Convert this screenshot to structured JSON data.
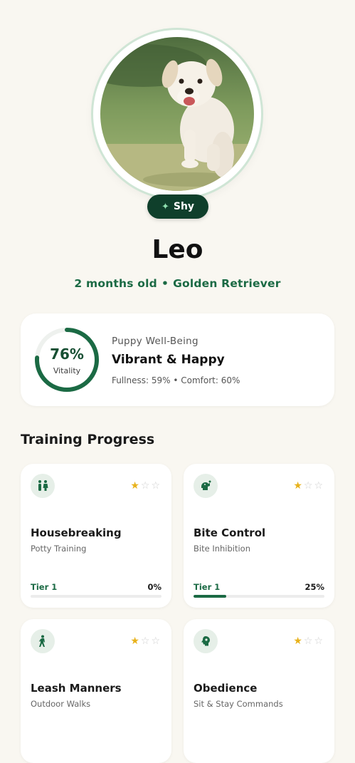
{
  "profile": {
    "name": "Leo",
    "age": "2 months old",
    "separator": "•",
    "breed": "Golden Retriever",
    "trait": "Shy",
    "trait_icon": "sparkle-icon"
  },
  "wellbeing": {
    "vitality_percent": 76,
    "vitality_label": "76%",
    "vitality_caption": "Vitality",
    "title": "Puppy Well-Being",
    "status": "Vibrant & Happy",
    "stats": "Fullness: 59% • Comfort: 60%"
  },
  "training": {
    "title": "Training Progress",
    "items": [
      {
        "icon": "restroom-icon",
        "title": "Housebreaking",
        "subtitle": "Potty Training",
        "tier": "Tier 1",
        "progress_label": "0%",
        "progress": 0,
        "stars": 1,
        "max_stars": 3
      },
      {
        "icon": "bite-icon",
        "title": "Bite Control",
        "subtitle": "Bite Inhibition",
        "tier": "Tier 1",
        "progress_label": "25%",
        "progress": 0.25,
        "stars": 1,
        "max_stars": 3
      },
      {
        "icon": "walking-icon",
        "title": "Leash Manners",
        "subtitle": "Outdoor Walks",
        "tier": "",
        "progress_label": "",
        "progress": null,
        "stars": 1,
        "max_stars": 3
      },
      {
        "icon": "brain-icon",
        "title": "Obedience",
        "subtitle": "Sit & Stay Commands",
        "tier": "",
        "progress_label": "",
        "progress": null,
        "stars": 1,
        "max_stars": 3
      }
    ]
  },
  "colors": {
    "accent": "#1b6a44",
    "badge_bg": "#0f3f2b",
    "star": "#e8b21b",
    "background": "#f9f7f1"
  }
}
